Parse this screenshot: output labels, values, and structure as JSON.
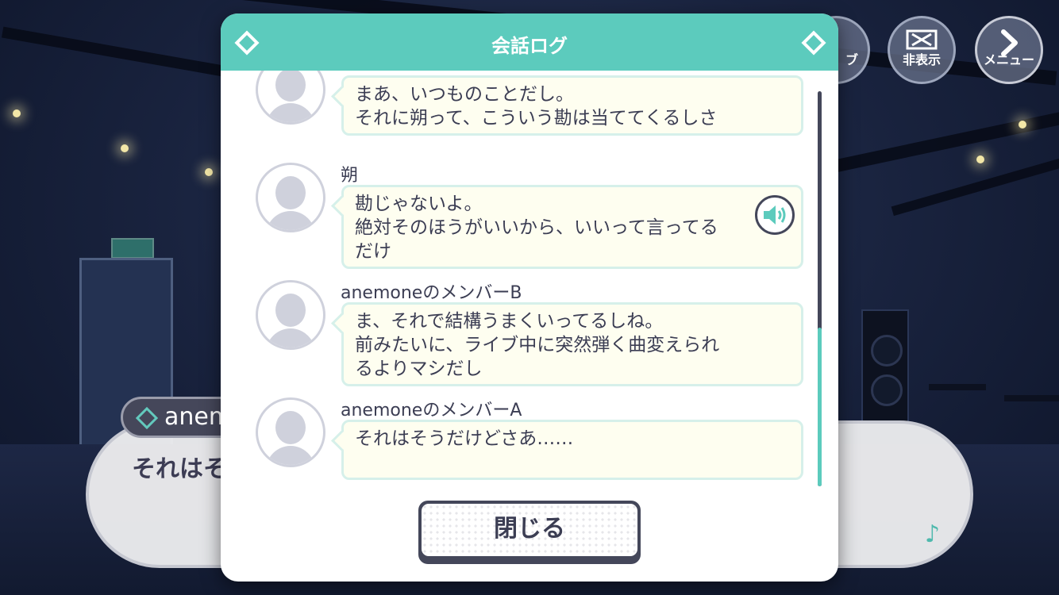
{
  "background_dialogue": {
    "speaker_name": "anem",
    "text": "それはそ"
  },
  "top_buttons": {
    "log_label": "ブ",
    "hide_label": "非表示",
    "menu_label": "メニュー"
  },
  "modal": {
    "title": "会話ログ",
    "close_label": "閉じる",
    "entries": [
      {
        "speaker": "",
        "text": "まあ、いつものことだし。\nそれに朔って、こういう勘は当ててくるしさ",
        "has_voice": false
      },
      {
        "speaker": "朔",
        "text": "勘じゃないよ。\n絶対そのほうがいいから、いいって言ってる\nだけ",
        "has_voice": true
      },
      {
        "speaker": "anemoneのメンバーB",
        "text": "ま、それで結構うまくいってるしね。\n前みたいに、ライブ中に突然弾く曲変えられ\nるよりマシだし",
        "has_voice": false
      },
      {
        "speaker": "anemoneのメンバーA",
        "text": "それはそうだけどさあ……",
        "has_voice": false
      }
    ]
  },
  "colors": {
    "accent": "#5ccbbd",
    "text": "#3b3d53",
    "bubble_bg": "#fefef0"
  }
}
